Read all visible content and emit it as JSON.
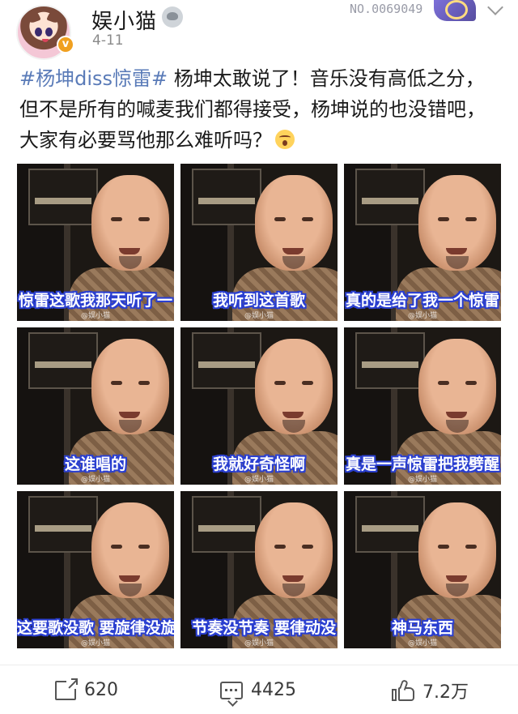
{
  "post": {
    "username": "娱小猫",
    "date": "4-11",
    "fan_badge_number": "NO.0069049",
    "hashtag": "#杨坤diss惊雷#",
    "text": "杨坤太敢说了！音乐没有高低之分，但不是所有的喊麦我们都得接受，杨坤说的也没错吧，大家有必要骂他那么难听吗？",
    "emoji": "thinking-face-emoji"
  },
  "images": [
    {
      "caption": "惊雷这歌我那天听了一",
      "align": "right"
    },
    {
      "caption": "我听到这首歌",
      "align": "center"
    },
    {
      "caption": "真的是给了我一个惊雷",
      "align": "right"
    },
    {
      "caption": "这谁唱的",
      "align": "center"
    },
    {
      "caption": "我就好奇怪啊",
      "align": "center"
    },
    {
      "caption": "真是一声惊雷把我劈醒",
      "align": "right"
    },
    {
      "caption": "这要歌没歌 要旋律没旋",
      "align": "right"
    },
    {
      "caption": "节奏没节奏 要律动没",
      "align": "right"
    },
    {
      "caption": "神马东西",
      "align": "center"
    }
  ],
  "watermark": "@娱小猫",
  "actions": {
    "repost_count": "620",
    "comment_count": "4425",
    "like_count": "7.2万"
  },
  "icons": {
    "repost": "share-icon",
    "comment": "comment-icon",
    "like": "thumbs-up-icon",
    "more": "chevron-down-icon",
    "verified": "verified-badge-icon"
  }
}
